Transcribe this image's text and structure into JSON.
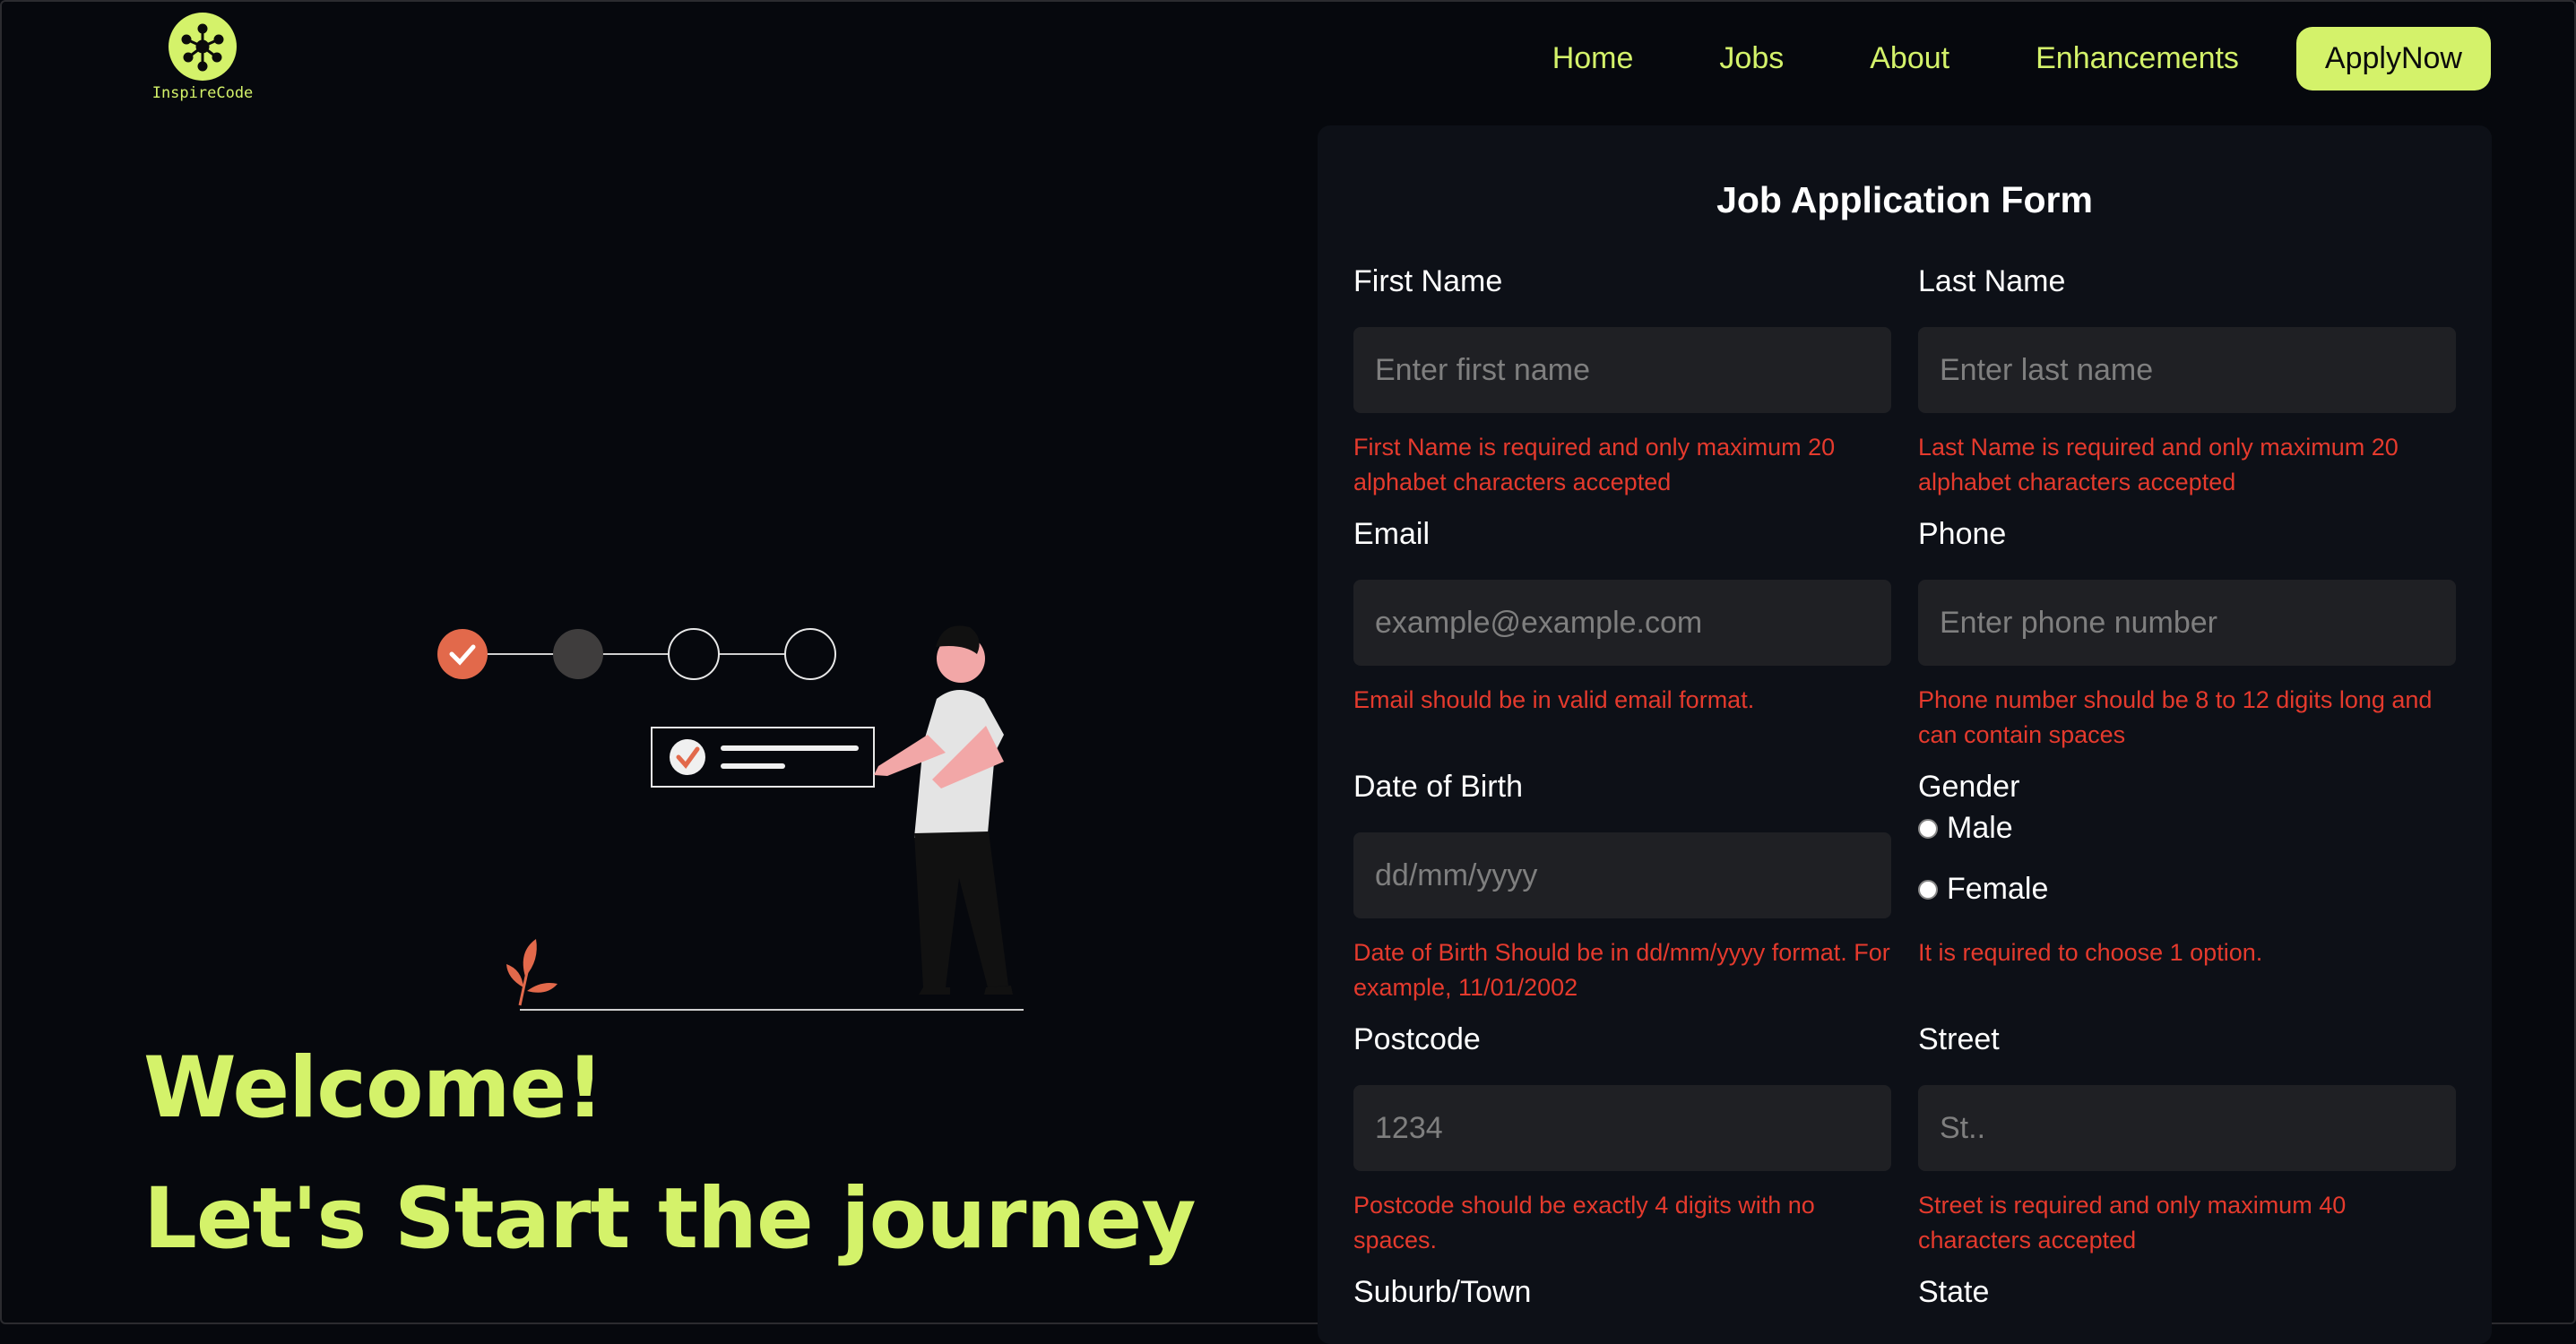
{
  "brand": {
    "name": "InspireCode",
    "color": "#d4f26a"
  },
  "nav": {
    "items": [
      {
        "label": "Home"
      },
      {
        "label": "Jobs"
      },
      {
        "label": "About"
      },
      {
        "label": "Enhancements"
      }
    ],
    "apply_label": "ApplyNow"
  },
  "hero": {
    "line1": "Welcome!",
    "line2": "Let's Start the journey"
  },
  "form": {
    "title": "Job Application Form",
    "first_name": {
      "label": "First Name",
      "placeholder": "Enter first name",
      "error": "First Name is required and only maximum 20 alphabet characters accepted"
    },
    "last_name": {
      "label": "Last Name",
      "placeholder": "Enter last name",
      "error": "Last Name is required and only maximum 20 alphabet characters accepted"
    },
    "email": {
      "label": "Email",
      "placeholder": "example@example.com",
      "error": "Email should be in valid email format."
    },
    "phone": {
      "label": "Phone",
      "placeholder": "Enter phone number",
      "error": "Phone number should be 8 to 12 digits long and can contain spaces"
    },
    "dob": {
      "label": "Date of Birth",
      "placeholder": "dd/mm/yyyy",
      "error": "Date of Birth Should be in dd/mm/yyyy format. For example, 11/01/2002"
    },
    "gender": {
      "label": "Gender",
      "options": [
        "Male",
        "Female"
      ],
      "error": "It is required to choose 1 option."
    },
    "postcode": {
      "label": "Postcode",
      "placeholder": "1234",
      "error": "Postcode should be exactly 4 digits with no spaces."
    },
    "street": {
      "label": "Street",
      "placeholder": "St..",
      "error": "Street is required and only maximum 40 characters accepted"
    },
    "suburb": {
      "label": "Suburb/Town"
    },
    "state": {
      "label": "State"
    }
  },
  "colors": {
    "accent": "#d4f26a",
    "error": "#e53a2d",
    "progress_done": "#e2694b"
  }
}
